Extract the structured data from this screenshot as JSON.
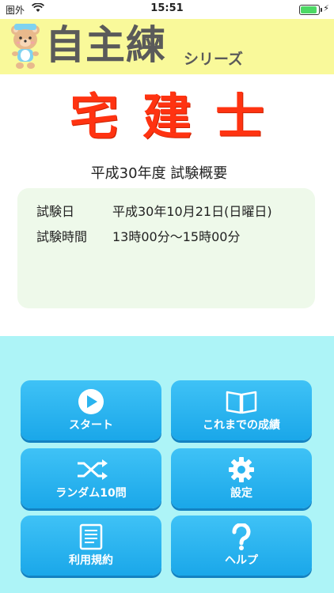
{
  "status_bar": {
    "carrier": "圏外",
    "time": "15:51",
    "battery_level": 0.85,
    "charging_symbol": "⚡"
  },
  "header": {
    "app_title": "自主練",
    "app_subtitle": "シリーズ",
    "bg_color": "#f9f99a"
  },
  "exam": {
    "title": "宅建士",
    "title_color": "#ff3311",
    "overview_title": "平成30年度 試験概要"
  },
  "info": {
    "rows": [
      {
        "label": "試験日",
        "value": "平成30年10月21日(日曜日)"
      },
      {
        "label": "試験時間",
        "value": "13時00分～15時00分"
      }
    ]
  },
  "menu": {
    "button_color": "#29b3ef",
    "area_color": "#adf4f7",
    "buttons": [
      {
        "label": "スタート",
        "icon": "play-icon"
      },
      {
        "label": "これまでの成績",
        "icon": "book-icon"
      },
      {
        "label": "ランダム10問",
        "icon": "shuffle-icon"
      },
      {
        "label": "設定",
        "icon": "gear-icon"
      },
      {
        "label": "利用規約",
        "icon": "document-icon"
      },
      {
        "label": "ヘルプ",
        "icon": "question-icon"
      }
    ]
  }
}
